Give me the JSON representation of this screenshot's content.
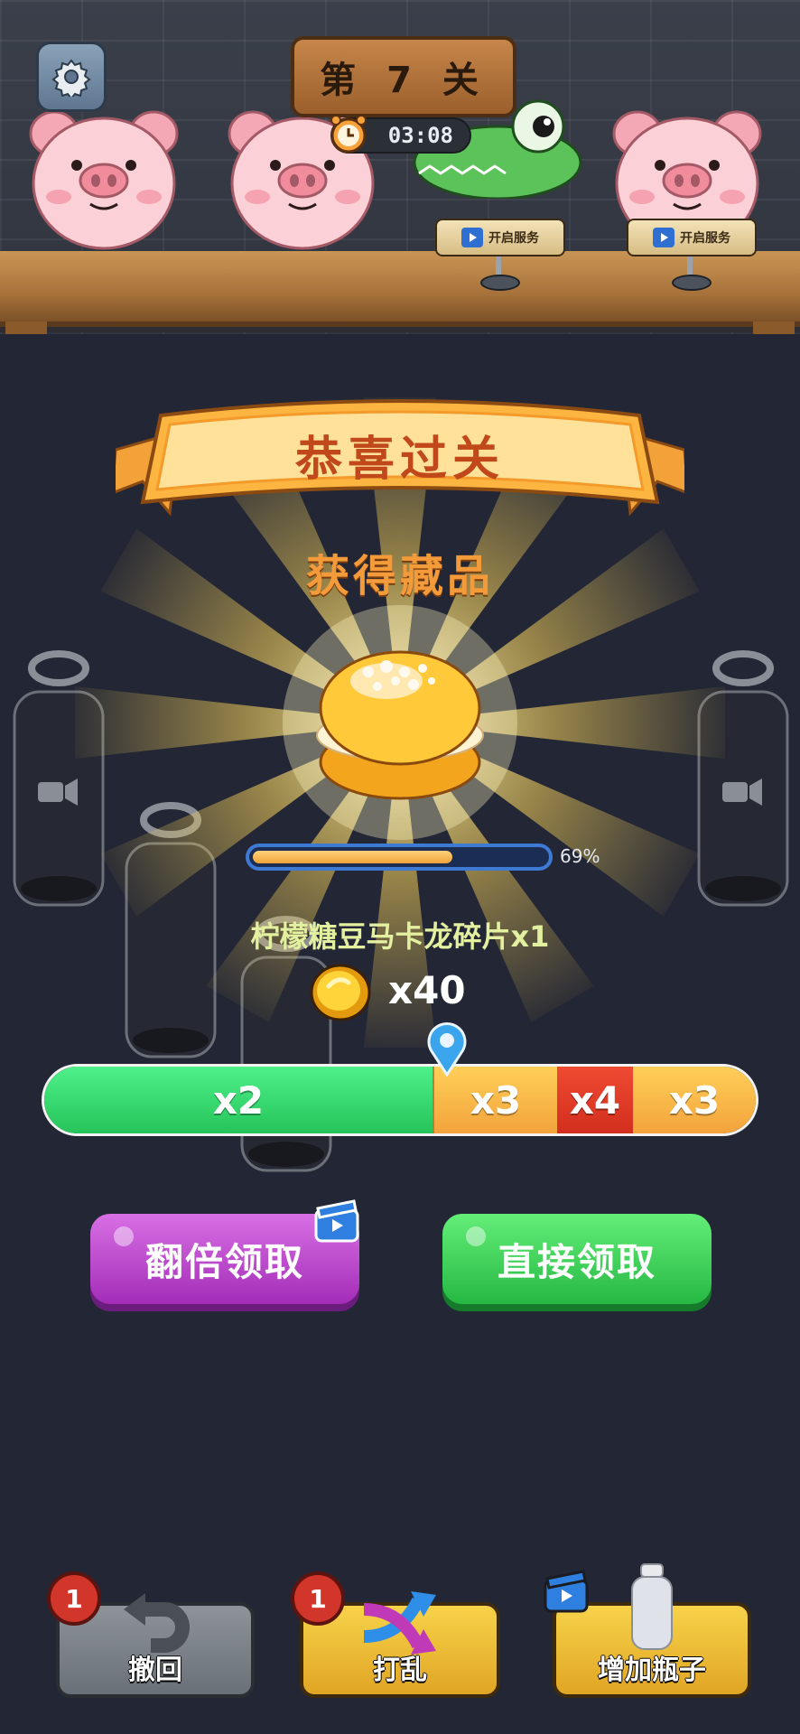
{
  "header": {
    "level_label": "第 7 关",
    "timer": "03:08",
    "serve_button_1": "开启服务",
    "serve_button_2": "开启服务"
  },
  "reward": {
    "banner_title": "恭喜过关",
    "collect_title": "获得藏品",
    "progress_percent": 69,
    "progress_text": "69%",
    "fragment_text": "柠檬糖豆马卡龙碎片x1",
    "coin_text": "x40"
  },
  "multiplier_bar": {
    "segments": [
      "x2",
      "x3",
      "x4",
      "x3"
    ]
  },
  "buttons": {
    "double_claim": "翻倍领取",
    "direct_claim": "直接领取"
  },
  "tools": {
    "undo_label": "撤回",
    "undo_count": "1",
    "shuffle_label": "打乱",
    "shuffle_count": "1",
    "add_bottle_label": "增加瓶子"
  },
  "colors": {
    "background": "#232634",
    "ribbon": "#f7a33b",
    "double_button": "#a32db7",
    "direct_button": "#26b843",
    "multiplier_green": "#26c45a",
    "multiplier_red": "#d22e1d",
    "multiplier_orange": "#f3a33c"
  },
  "icons": [
    "gear-icon",
    "alarm-clock-icon",
    "video-icon",
    "coin-icon",
    "location-pin-icon",
    "undo-arrow-icon",
    "shuffle-arrows-icon",
    "bottle-icon"
  ]
}
